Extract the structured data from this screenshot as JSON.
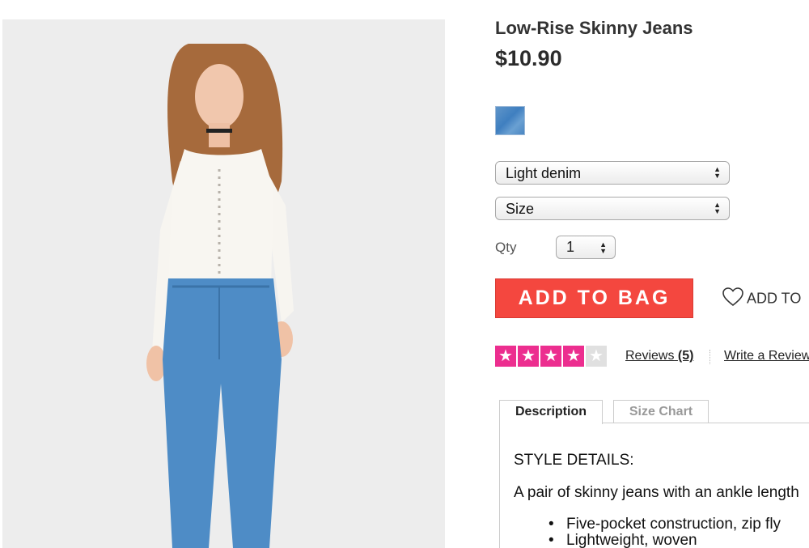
{
  "product": {
    "title": "Low-Rise Skinny Jeans",
    "price": "$10.90",
    "swatch_color": "#4a86c2"
  },
  "options": {
    "color_selected": "Light denim",
    "size_selected": "Size",
    "qty_label": "Qty",
    "qty_selected": "1"
  },
  "actions": {
    "add_to_bag": "ADD TO BAG",
    "wishlist": "ADD TO"
  },
  "rating": {
    "filled": 4,
    "total": 5,
    "reviews_label": "Reviews",
    "reviews_count": "(5)",
    "write_review": "Write a Review"
  },
  "tabs": {
    "description": "Description",
    "size_chart": "Size Chart"
  },
  "description": {
    "heading": "STYLE DETAILS:",
    "text": "A pair of skinny jeans with an ankle length",
    "bullets": [
      "Five-pocket construction, zip fly",
      "Lightweight, woven"
    ]
  },
  "colors": {
    "accent": "#f4473f",
    "star": "#ec2e8f"
  }
}
